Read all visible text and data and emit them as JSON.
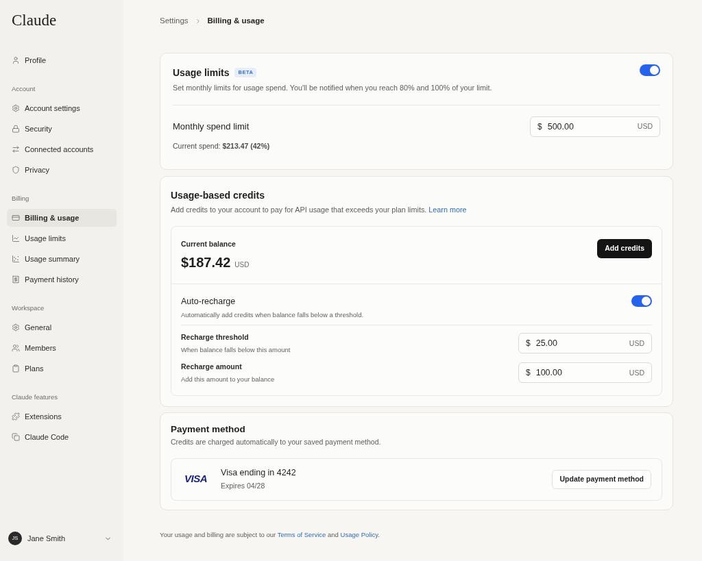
{
  "sidebar": {
    "logo": "Claude",
    "sections": [
      {
        "items": [
          {
            "label": "Profile",
            "selected": false
          }
        ]
      },
      {
        "heading": "Account",
        "items": [
          {
            "label": "Account settings",
            "selected": false
          },
          {
            "label": "Security",
            "selected": false
          },
          {
            "label": "Connected accounts",
            "selected": false
          },
          {
            "label": "Privacy",
            "selected": false
          }
        ]
      },
      {
        "heading": "Billing",
        "items": [
          {
            "label": "Billing & usage",
            "selected": true
          },
          {
            "label": "Usage limits",
            "selected": false
          },
          {
            "label": "Usage summary",
            "selected": false
          },
          {
            "label": "Payment history",
            "selected": false
          }
        ]
      },
      {
        "heading": "Workspace",
        "items": [
          {
            "label": "General",
            "selected": false
          },
          {
            "label": "Members",
            "selected": false
          },
          {
            "label": "Plans",
            "selected": false
          }
        ]
      },
      {
        "heading": "Claude features",
        "items": [
          {
            "label": "Extensions",
            "selected": false
          },
          {
            "label": "Claude Code",
            "selected": false
          }
        ]
      }
    ],
    "user": {
      "initials": "JS",
      "name": "Jane Smith"
    }
  },
  "breadcrumb": [
    {
      "label": "Settings",
      "current": false
    },
    {
      "label": "Billing & usage",
      "current": true
    }
  ],
  "usage_limits": {
    "title": "Usage limits",
    "badge": "BETA",
    "on": true,
    "description": "Set monthly limits for usage spend. You'll be notified when you reach 80% and 100% of your limit.",
    "spend_limit": {
      "label": "Monthly spend limit",
      "currency_symbol": "$",
      "value": "500.00",
      "currency": "USD"
    },
    "current_spend": "Current spend: **$213.47 (42%)**"
  },
  "credits": {
    "title": "Usage-based credits",
    "description": "Add credits to your account to pay for API usage that exceeds your plan limits.",
    "link": "Learn more",
    "balance": {
      "label": "Current balance",
      "amount": "$187.42",
      "currency": "USD",
      "button": "Add credits"
    },
    "auto_recharge": {
      "title": "Auto-recharge",
      "description": "Automatically add credits when balance falls below a threshold.",
      "on": true
    },
    "fields": [
      {
        "label": "Recharge threshold",
        "description": "When balance falls below this amount",
        "currency_symbol": "$",
        "value": "25.00",
        "currency": "USD"
      },
      {
        "label": "Recharge amount",
        "description": "Add this amount to your balance",
        "currency_symbol": "$",
        "value": "100.00",
        "currency": "USD"
      }
    ]
  },
  "payment": {
    "title": "Payment method",
    "description": "Credits are charged automatically to your saved payment method.",
    "card": {
      "brand": "VISA",
      "name": "Visa ending in 4242",
      "expiry": "Expires 04/28"
    },
    "button": "Update payment method"
  },
  "footer": [
    {
      "kind": "text",
      "text": "Your usage and billing are subject to our "
    },
    {
      "kind": "link",
      "text": "Terms of Service"
    },
    {
      "kind": "text",
      "text": " and "
    },
    {
      "kind": "link",
      "text": "Usage Policy"
    },
    {
      "kind": "text",
      "text": "."
    }
  ]
}
